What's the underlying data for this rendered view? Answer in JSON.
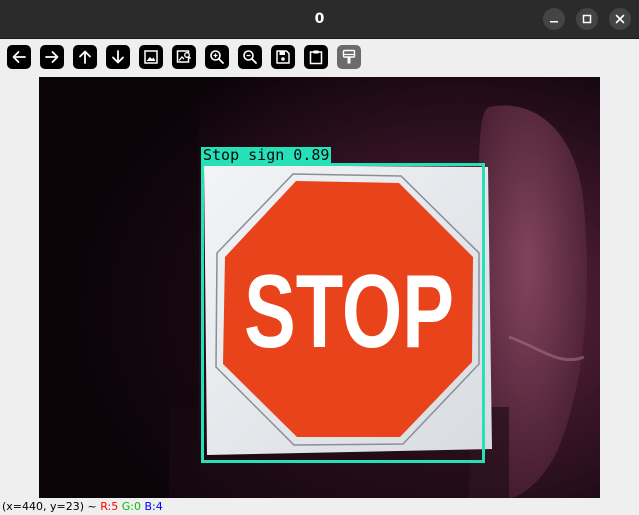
{
  "window": {
    "title": "0"
  },
  "toolbar": {
    "tools": [
      {
        "name": "pan-left",
        "icon": "arrow-left-icon",
        "enabled": true
      },
      {
        "name": "pan-right",
        "icon": "arrow-right-icon",
        "enabled": true
      },
      {
        "name": "pan-up",
        "icon": "arrow-up-icon",
        "enabled": true
      },
      {
        "name": "pan-down",
        "icon": "arrow-down-icon",
        "enabled": true
      },
      {
        "name": "zoom-fit",
        "icon": "image-icon",
        "enabled": true
      },
      {
        "name": "zoom-original",
        "icon": "image-zoom-icon",
        "enabled": true
      },
      {
        "name": "zoom-in",
        "icon": "zoom-in-icon",
        "enabled": true
      },
      {
        "name": "zoom-out",
        "icon": "zoom-out-icon",
        "enabled": true
      },
      {
        "name": "save",
        "icon": "floppy-disk-icon",
        "enabled": true
      },
      {
        "name": "copy",
        "icon": "clipboard-icon",
        "enabled": true
      },
      {
        "name": "properties",
        "icon": "paint-brush-icon",
        "enabled": false
      }
    ]
  },
  "image": {
    "detection": {
      "label": "Stop sign 0.89",
      "box_color": "#26e0b8"
    },
    "sign_text": "STOP"
  },
  "status": {
    "coords": "(x=440, y=23) ~",
    "r": "R:5",
    "g": "G:0",
    "b": "B:4"
  },
  "colors": {
    "titlebar": "#2b2b2b",
    "toolbar_bg": "#efefef",
    "stop_red": "#e8431a",
    "detection": "#26e0b8"
  }
}
